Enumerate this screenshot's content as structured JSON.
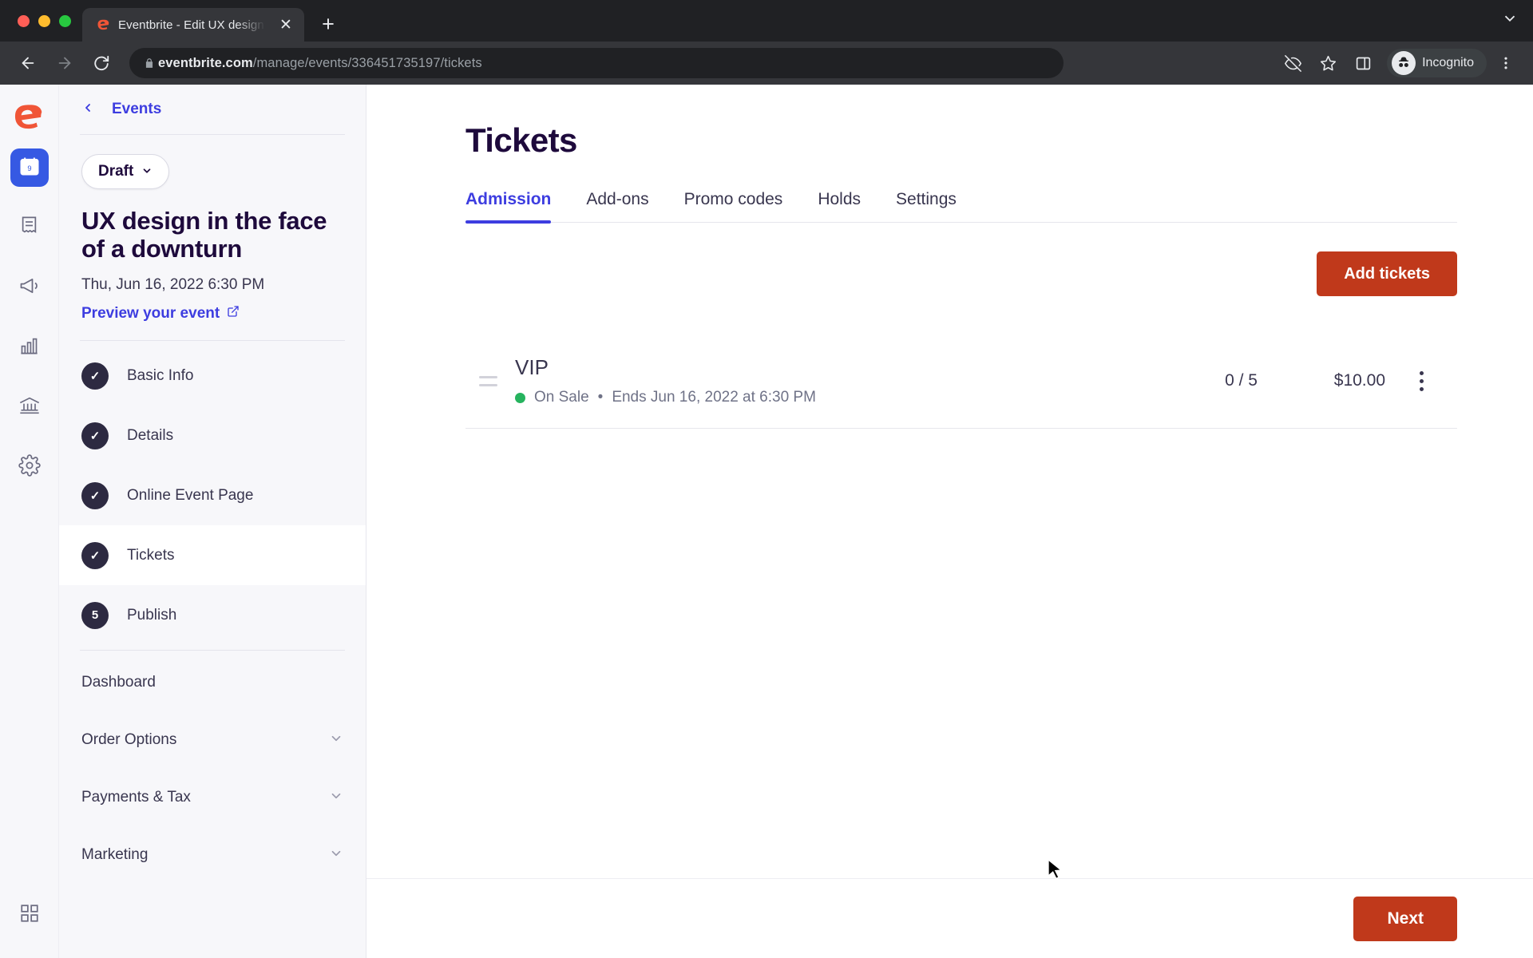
{
  "browser": {
    "tab": {
      "title": "Eventbrite - Edit UX design in t",
      "favicon_icon": "eventbrite-e-icon",
      "close_icon": "close-icon"
    },
    "new_tab_icon": "plus-icon",
    "window_chevron_icon": "chevron-down-icon",
    "back_icon": "arrow-left-icon",
    "forward_icon": "arrow-right-icon",
    "reload_icon": "reload-icon",
    "lock_icon": "lock-icon",
    "url": {
      "domain": "eventbrite.com",
      "path": "/manage/events/336451735197/tickets"
    },
    "toolbar_icons": [
      "eye-slash-icon",
      "star-icon",
      "side-panel-icon"
    ],
    "profile": {
      "label": "Incognito",
      "icon": "incognito-icon"
    },
    "menu_icon": "three-dots-vertical-icon"
  },
  "rail": {
    "logo_icon": "eventbrite-logo-icon",
    "items": [
      {
        "name": "calendar-icon",
        "active": true
      },
      {
        "name": "receipt-icon",
        "active": false
      },
      {
        "name": "megaphone-icon",
        "active": false
      },
      {
        "name": "bar-chart-icon",
        "active": false
      },
      {
        "name": "bank-icon",
        "active": false
      },
      {
        "name": "gear-icon",
        "active": false
      }
    ],
    "bottom_icon": "apps-grid-icon"
  },
  "sidebar": {
    "back_label": "Events",
    "back_icon": "chevron-left-icon",
    "status": {
      "label": "Draft",
      "chevron_icon": "chevron-down-icon"
    },
    "event_title": "UX design in the face of a downturn",
    "event_date": "Thu, Jun 16, 2022 6:30 PM",
    "preview_label": "Preview your event",
    "preview_icon": "external-link-icon",
    "steps": [
      {
        "label": "Basic Info",
        "marker": "✓",
        "selected": false
      },
      {
        "label": "Details",
        "marker": "✓",
        "selected": false
      },
      {
        "label": "Online Event Page",
        "marker": "✓",
        "selected": false
      },
      {
        "label": "Tickets",
        "marker": "✓",
        "selected": true
      },
      {
        "label": "Publish",
        "marker": "5",
        "selected": false
      }
    ],
    "groups": [
      {
        "label": "Dashboard",
        "chevron": ""
      },
      {
        "label": "Order Options",
        "chevron": "∨"
      },
      {
        "label": "Payments & Tax",
        "chevron": "∨"
      },
      {
        "label": "Marketing",
        "chevron": "∨"
      }
    ]
  },
  "main": {
    "title": "Tickets",
    "tabs": [
      {
        "label": "Admission",
        "active": true
      },
      {
        "label": "Add-ons",
        "active": false
      },
      {
        "label": "Promo codes",
        "active": false
      },
      {
        "label": "Holds",
        "active": false
      },
      {
        "label": "Settings",
        "active": false
      }
    ],
    "add_tickets_label": "Add tickets",
    "tickets": [
      {
        "name": "VIP",
        "status": "On Sale",
        "separator": "•",
        "ends": "Ends Jun 16, 2022 at 6:30 PM",
        "quantity": "0 / 5",
        "price": "$10.00",
        "menu_icon": "kebab-menu-icon",
        "drag_icon": "drag-handle-icon"
      }
    ],
    "next_label": "Next"
  },
  "colors": {
    "brand_blue": "#3d3de0",
    "accent_red": "#c0391b",
    "status_green": "#26b35e",
    "dark_navy": "#1e0a3c",
    "sidebar_bg": "#f7f7fa"
  }
}
